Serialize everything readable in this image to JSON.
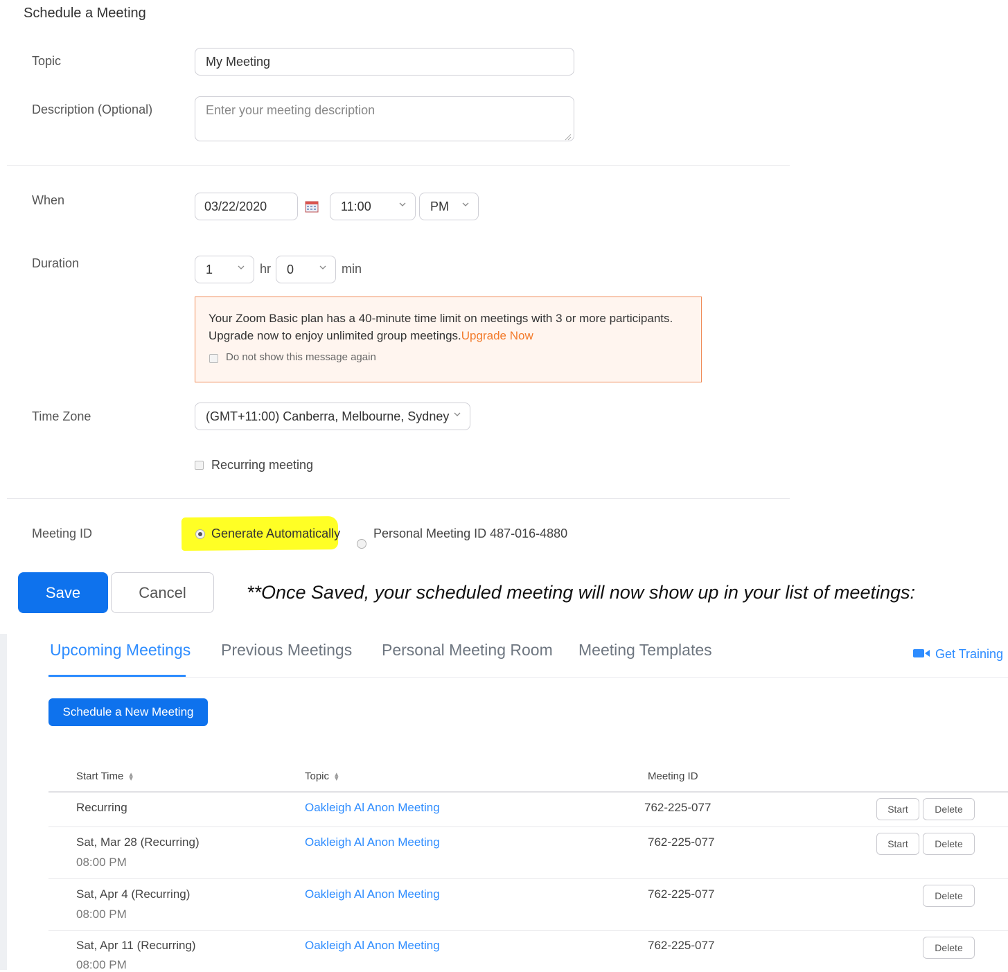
{
  "form": {
    "title": "Schedule a Meeting",
    "topic_label": "Topic",
    "topic_value": "My Meeting",
    "description_label": "Description (Optional)",
    "description_placeholder": "Enter your meeting description",
    "when_label": "When",
    "date_value": "03/22/2020",
    "time_value": "11:00",
    "ampm_value": "PM",
    "duration_label": "Duration",
    "duration_hr": "1",
    "hr_unit": "hr",
    "duration_min": "0",
    "min_unit": "min",
    "warning_line1": "Your Zoom Basic plan has a 40-minute time limit on meetings with 3 or more participants.",
    "warning_line2": "Upgrade now to enjoy unlimited group meetings.",
    "upgrade_link": "Upgrade Now",
    "dont_show": "Do not show this message again",
    "timezone_label": "Time Zone",
    "timezone_value": "(GMT+11:00) Canberra, Melbourne, Sydney",
    "recurring_label": "Recurring meeting",
    "meeting_id_label": "Meeting ID",
    "generate_auto": "Generate Automatically",
    "personal_id": "Personal Meeting ID 487-016-4880",
    "save": "Save",
    "cancel": "Cancel",
    "highlight_color": "#ffff25",
    "accent_color": "#0e72ed"
  },
  "note": "**Once Saved, your scheduled meeting will now show up in your list of meetings:",
  "meetings": {
    "tabs": [
      "Upcoming Meetings",
      "Previous Meetings",
      "Personal Meeting Room",
      "Meeting Templates"
    ],
    "get_training": "Get Training",
    "training_icon": "video-camera-icon",
    "schedule_new": "Schedule a New Meeting",
    "headers": {
      "start_time": "Start Time",
      "topic": "Topic",
      "meeting_id": "Meeting ID"
    },
    "rows": [
      {
        "start": "Recurring",
        "time": "",
        "topic": "Oakleigh Al Anon Meeting",
        "id": "762-225-077",
        "start_btn": "Start",
        "delete_btn": "Delete"
      },
      {
        "start": "Sat, Mar 28 (Recurring)",
        "time": "08:00 PM",
        "topic": "Oakleigh Al Anon Meeting",
        "id": "762-225-077",
        "start_btn": "Start",
        "delete_btn": "Delete"
      },
      {
        "start": "Sat, Apr 4 (Recurring)",
        "time": "08:00 PM",
        "topic": "Oakleigh Al Anon Meeting",
        "id": "762-225-077",
        "delete_btn": "Delete"
      },
      {
        "start": "Sat, Apr 11 (Recurring)",
        "time": "08:00 PM",
        "topic": "Oakleigh Al Anon Meeting",
        "id": "762-225-077",
        "delete_btn": "Delete"
      }
    ]
  }
}
